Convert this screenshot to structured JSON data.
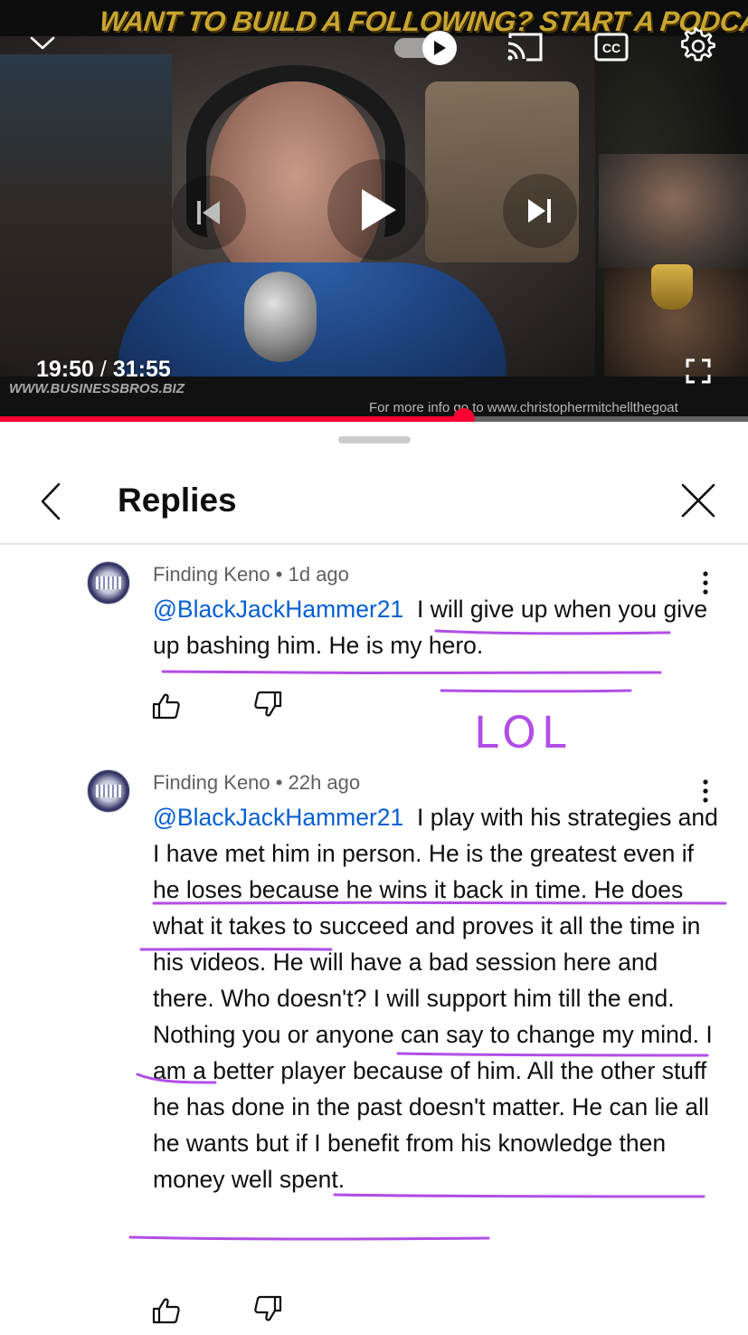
{
  "player": {
    "banner_text": "WANT TO BUILD A FOLLOWING? START A PODCAST!",
    "site_url": "WWW.BUSINESSBROS.BIZ",
    "info_text": "For more info go to www.christophermitchellthegoat",
    "time_current": "19:50",
    "time_separator": "/",
    "time_total": "31:55",
    "progress_fraction": 0.62,
    "autoplay_on": true,
    "accent_color": "#ff0033",
    "icons": [
      "chevron-down-icon",
      "autoplay-toggle-icon",
      "cast-icon",
      "closed-captions-icon",
      "settings-gear-icon",
      "previous-icon",
      "play-icon",
      "next-icon",
      "fullscreen-icon"
    ]
  },
  "replies_panel": {
    "title": "Replies",
    "icons": [
      "back-arrow-icon",
      "close-icon"
    ]
  },
  "comments": [
    {
      "author": "Finding Keno",
      "separator": "•",
      "time": "1d ago",
      "mention": "@BlackJackHammer21",
      "text": "I will give up when you give up bashing him. He is my hero."
    },
    {
      "author": "Finding Keno",
      "separator": "•",
      "time": "22h ago",
      "mention": "@BlackJackHammer21",
      "text": "I play with his strategies and I have met him in person. He is the greatest even if he loses because he wins it back in time. He does what it takes to succeed and proves it all the time in his videos. He will have a bad session here and there. Who doesn't? I will support him till the end. Nothing you or anyone can say to change my mind. I am a better player because of him. All the other stuff he has done in the past doesn't matter. He can lie all he wants but if I benefit from his knowledge then money well spent."
    }
  ],
  "annotations": {
    "handwritten_text": "LOL",
    "marker_color": "#b14ee6"
  }
}
